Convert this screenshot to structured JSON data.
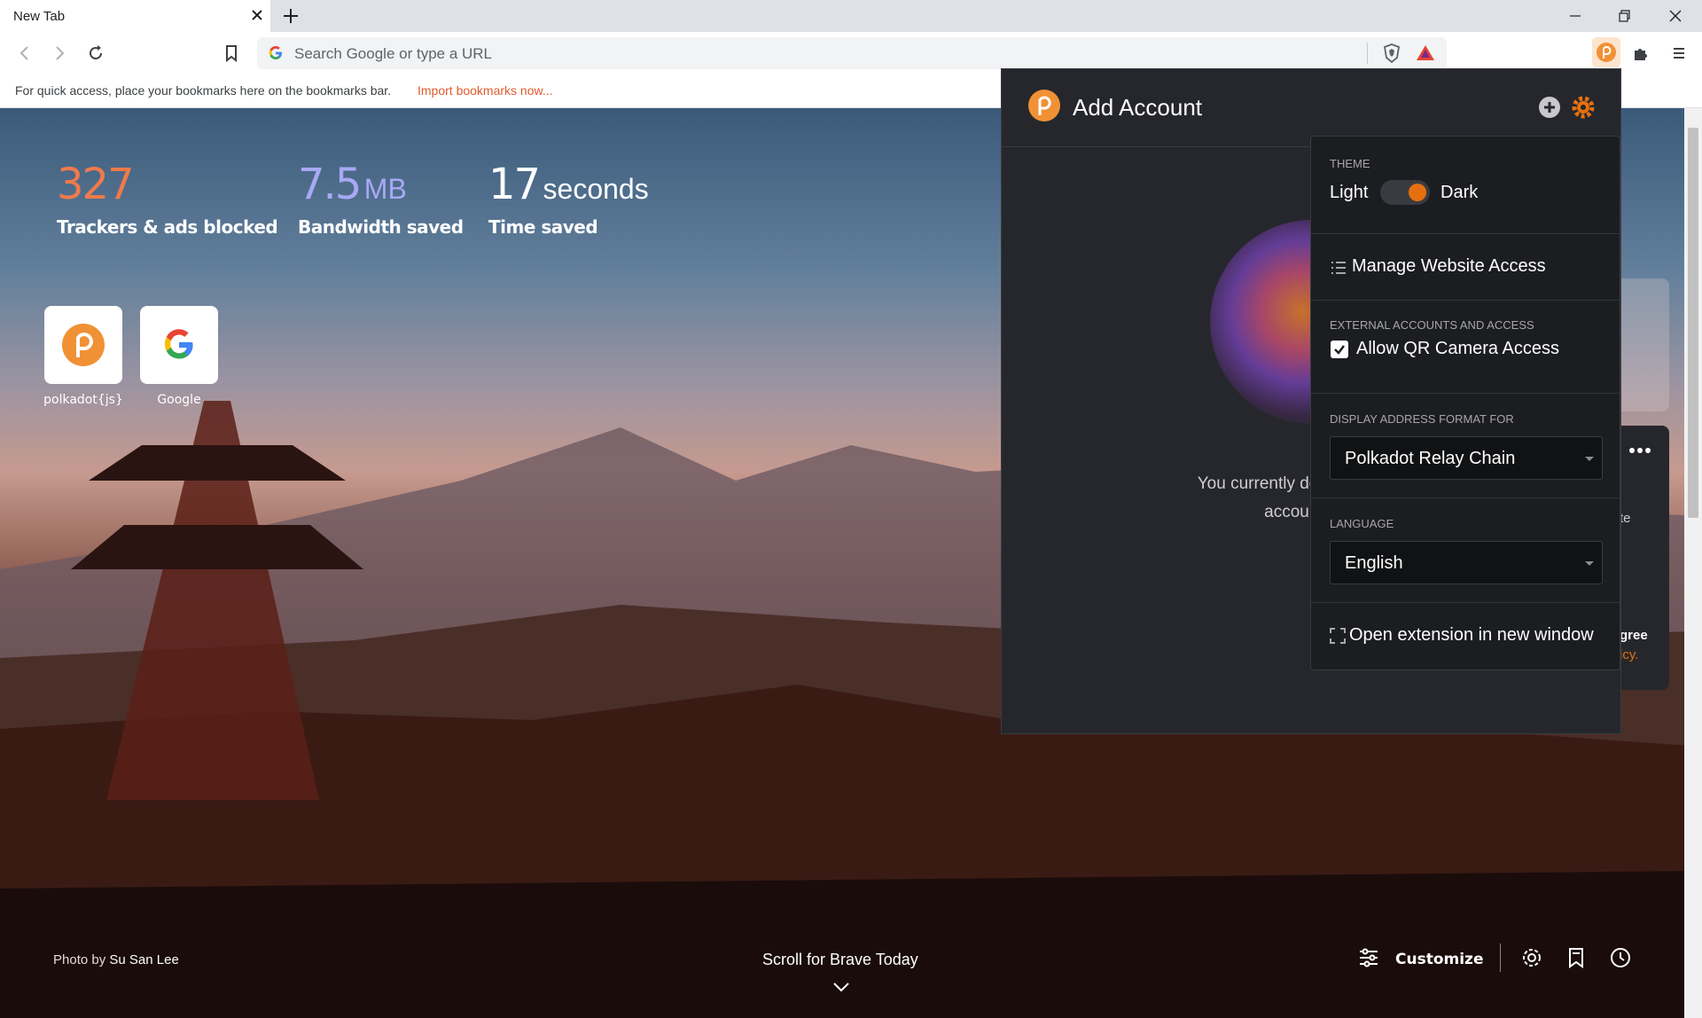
{
  "browser": {
    "tab_title": "New Tab",
    "omnibox_placeholder": "Search Google or type a URL",
    "bookmarks_hint": "For quick access, place your bookmarks here on the bookmarks bar.",
    "import_link": "Import bookmarks now..."
  },
  "stats": [
    {
      "value": "327",
      "unit": "",
      "label": "Trackers & ads blocked",
      "color": "#f07a4b"
    },
    {
      "value": "7.5",
      "unit": "MB",
      "label": "Bandwidth saved",
      "color": "#a7a9f5"
    },
    {
      "value": "17",
      "unit": "seconds",
      "label": "Time saved",
      "color": "#ffffff"
    }
  ],
  "top_sites": [
    {
      "label": "polkadot{js}",
      "icon": "polkadot-logo-icon"
    },
    {
      "label": "Google",
      "icon": "google-logo-icon"
    }
  ],
  "ntp_footer": {
    "photo_prefix": "Photo by",
    "photographer": "Su San Lee",
    "scroll_label": "Scroll for Brave Today",
    "customize_label": "Customize"
  },
  "extension": {
    "title": "Add Account",
    "empty_line1": "You currently don't have any",
    "empty_line2": "account to",
    "accent": "#e6700f"
  },
  "settings_menu": {
    "theme_title": "THEME",
    "theme_light": "Light",
    "theme_dark": "Dark",
    "theme_value": "dark",
    "manage_access": "Manage Website Access",
    "external_title": "EXTERNAL ACCOUNTS AND ACCESS",
    "qr_label": "Allow QR Camera Access",
    "qr_checked": true,
    "address_title": "DISPLAY ADDRESS FORMAT FOR",
    "address_value": "Polkadot Relay Chain",
    "language_title": "LANGUAGE",
    "language_value": "English",
    "open_window": "Open extension in new window"
  },
  "side_panel_fragments": {
    "text1": "te",
    "text2": "gree",
    "text3": "icy."
  }
}
